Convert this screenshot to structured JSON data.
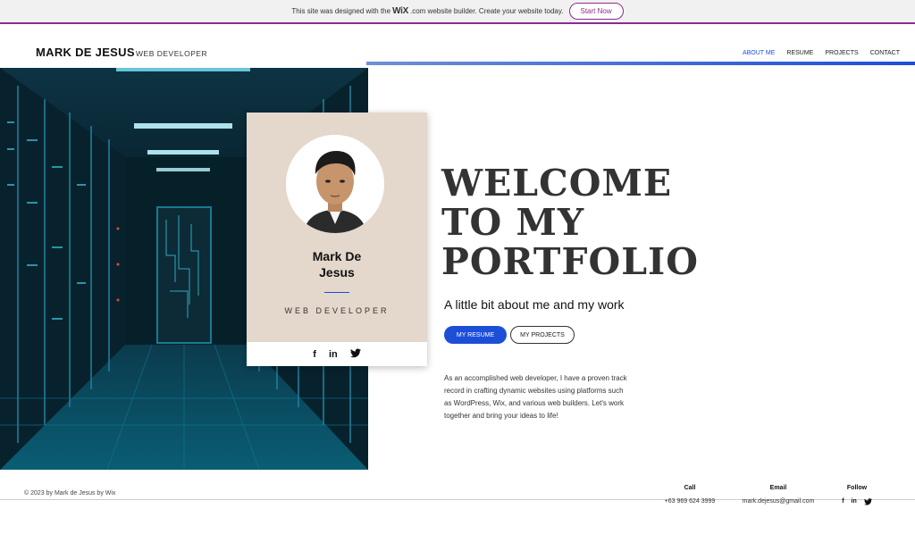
{
  "banner": {
    "text_before": "This site was designed with the",
    "wix_logo": "WiX",
    "text_after": ".com website builder. Create your website today.",
    "cta": "Start Now"
  },
  "header": {
    "name": "MARK DE JESUS",
    "tagline": "WEB DEVELOPER",
    "nav": [
      {
        "label": "ABOUT ME",
        "active": true
      },
      {
        "label": "RESUME",
        "active": false
      },
      {
        "label": "PROJECTS",
        "active": false
      },
      {
        "label": "CONTACT",
        "active": false
      }
    ]
  },
  "card": {
    "name_line1": "Mark De",
    "name_line2": "Jesus",
    "role": "WEB DEVELOPER",
    "social_icons": [
      "facebook-icon",
      "linkedin-icon",
      "twitter-icon"
    ]
  },
  "hero": {
    "welcome_line1": "WELCOME",
    "welcome_line2": "TO MY",
    "welcome_line3": "PORTFOLIO",
    "subtitle": "A little bit about me and my work",
    "resume_button": "MY RESUME",
    "projects_button": "MY PROJECTS",
    "bio": "As an accomplished web developer, I have a proven track record in crafting dynamic websites using platforms such as WordPress, Wix, and various web builders.  Let's work together and bring your ideas to life!"
  },
  "footer": {
    "copyright": "© 2023 by Mark de Jesus by Wix",
    "call_label": "Call",
    "call_value": "+63 969 624 3999",
    "email_label": "Email",
    "email_value": "mark.dejesus@gmail.com",
    "follow_label": "Follow"
  },
  "colors": {
    "accent": "#1d4ed8",
    "banner_border": "#8b2d8f",
    "card_bg": "#e4d7cc"
  }
}
